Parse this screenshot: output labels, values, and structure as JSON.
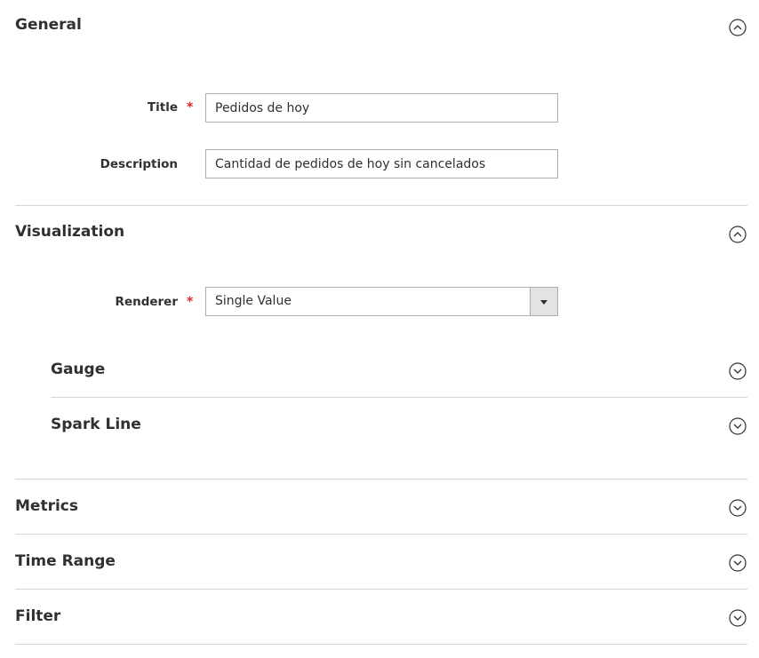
{
  "sections": {
    "general": {
      "title": "General",
      "toggle_icon": "chevron-up-circle-icon",
      "fields": {
        "title": {
          "label": "Title",
          "required_mark": "*",
          "value": "Pedidos de hoy"
        },
        "description": {
          "label": "Description",
          "value": "Cantidad de pedidos de hoy sin cancelados"
        }
      }
    },
    "visualization": {
      "title": "Visualization",
      "toggle_icon": "chevron-up-circle-icon",
      "fields": {
        "renderer": {
          "label": "Renderer",
          "required_mark": "*",
          "value": "Single Value"
        }
      },
      "subsections": {
        "gauge": {
          "title": "Gauge",
          "toggle_icon": "chevron-down-circle-icon"
        },
        "spark_line": {
          "title": "Spark Line",
          "toggle_icon": "chevron-down-circle-icon"
        }
      }
    },
    "metrics": {
      "title": "Metrics",
      "toggle_icon": "chevron-down-circle-icon"
    },
    "time_range": {
      "title": "Time Range",
      "toggle_icon": "chevron-down-circle-icon"
    },
    "filter": {
      "title": "Filter",
      "toggle_icon": "chevron-down-circle-icon"
    }
  },
  "colors": {
    "required": "#e22626",
    "text": "#303030",
    "divider": "#d6d6d6",
    "input_border": "#adadad"
  }
}
